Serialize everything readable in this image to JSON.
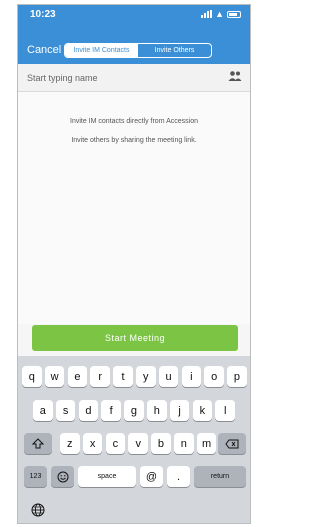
{
  "status_bar": {
    "time": "10:23"
  },
  "nav": {
    "cancel_label": "Cancel",
    "segments": [
      "Invite IM Contacts",
      "Invite Others"
    ]
  },
  "search": {
    "placeholder": "Start typing name"
  },
  "info": {
    "line1": "Invite IM contacts directly from Accession",
    "line2": "Invite others by sharing the meeting link."
  },
  "start_button_label": "Start Meeting",
  "keyboard": {
    "row1": [
      "q",
      "w",
      "e",
      "r",
      "t",
      "y",
      "u",
      "i",
      "o",
      "p"
    ],
    "row2": [
      "a",
      "s",
      "d",
      "f",
      "g",
      "h",
      "j",
      "k",
      "l"
    ],
    "row3": [
      "z",
      "x",
      "c",
      "v",
      "b",
      "n",
      "m"
    ],
    "numbers_label": "123",
    "space_label": "space",
    "at_label": "@",
    "dot_label": ".",
    "return_label": "return"
  },
  "colors": {
    "header": "#3a8fd6",
    "start_button": "#7cc444"
  },
  "icons": [
    "signal-icon",
    "wifi-icon",
    "battery-icon",
    "contacts-icon",
    "shift-icon",
    "backspace-icon",
    "emoji-icon",
    "globe-icon"
  ]
}
